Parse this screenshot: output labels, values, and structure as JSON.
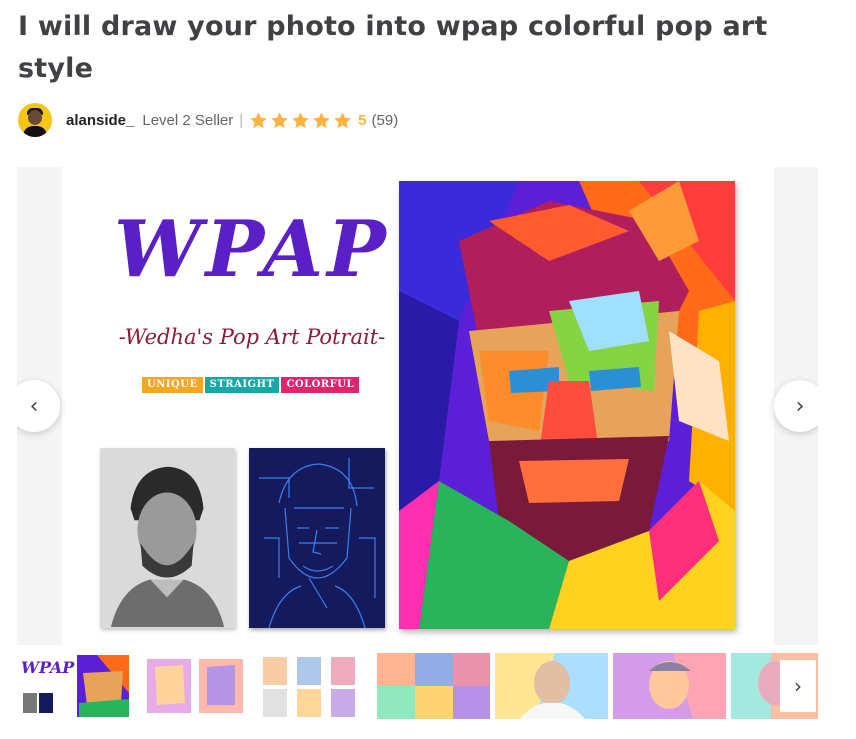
{
  "gig": {
    "title": "I will draw your photo into wpap colorful pop art style"
  },
  "seller": {
    "username": "alanside_",
    "level": "Level 2 Seller",
    "separator": "|",
    "rating": "5",
    "stars": 5,
    "review_count": "(59)"
  },
  "slide": {
    "logo": "WPAP",
    "subtitle": "-Wedha's Pop Art Potrait-",
    "tags": [
      "UNIQUE",
      "STRAIGHT",
      "COLORFUL"
    ]
  },
  "nav": {
    "prev_icon": "‹",
    "next_icon": "›",
    "thumb_next_icon": "›"
  },
  "colors": {
    "title": "#404145",
    "star": "#ffb33e",
    "logo": "#5b1fc7",
    "subtitle": "#8a1c3a",
    "tag_unique": "#f5a623",
    "tag_straight": "#1aa6a6",
    "tag_colorful": "#e0246d"
  }
}
